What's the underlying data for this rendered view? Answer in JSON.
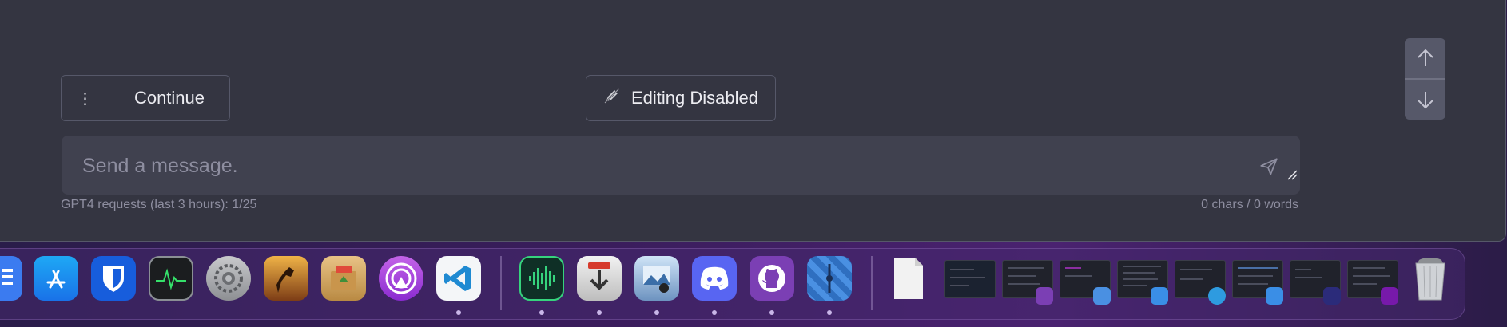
{
  "chat": {
    "continue_label": "Continue",
    "more_glyph": "⋮",
    "editing_label": "Editing Disabled",
    "input_placeholder": "Send a message.",
    "usage_text": "GPT4 requests (last 3 hours): 1/25",
    "counter_text": "0 chars / 0 words"
  },
  "dock": {
    "apps": [
      "google-docs",
      "app-store",
      "bitwarden",
      "activity-monitor",
      "system-settings",
      "game",
      "archive-utility",
      "podcast-app",
      "visual-studio-code",
      "audio-app",
      "downie",
      "preview",
      "discord",
      "github-desktop",
      "split-app"
    ],
    "running": [
      "visual-studio-code",
      "audio-app",
      "downie",
      "preview",
      "discord",
      "github-desktop",
      "split-app"
    ]
  },
  "colors": {
    "window_bg": "#343541",
    "input_bg": "#40414f",
    "border": "#565869",
    "text": "#ececf1",
    "muted": "#8e8ea0"
  }
}
